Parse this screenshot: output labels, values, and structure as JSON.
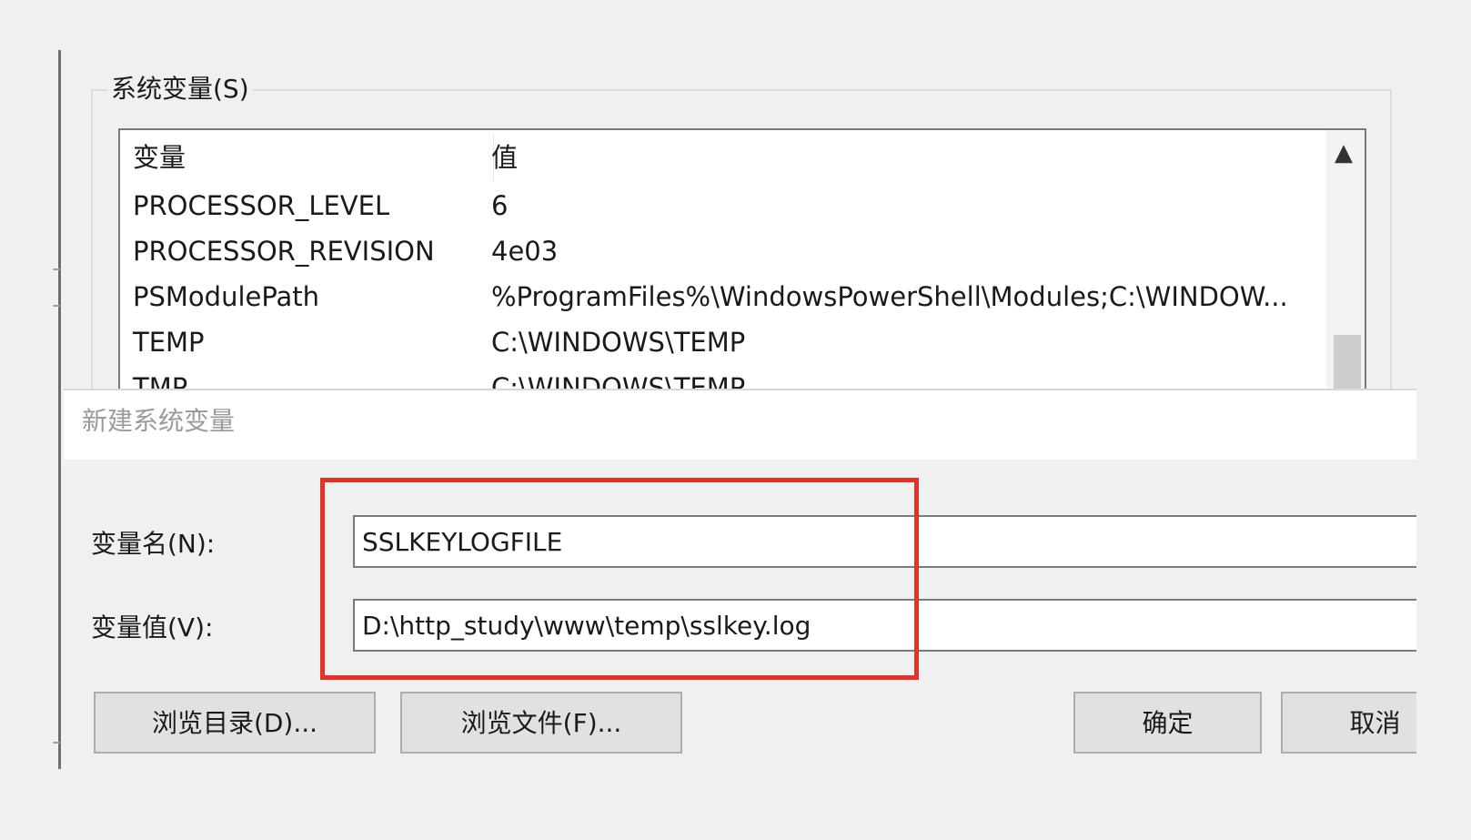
{
  "system_vars": {
    "group_title": "系统变量(S)",
    "columns": {
      "name": "变量",
      "value": "值"
    },
    "rows": [
      {
        "name": "PROCESSOR_LEVEL",
        "value": "6"
      },
      {
        "name": "PROCESSOR_REVISION",
        "value": "4e03"
      },
      {
        "name": "PSModulePath",
        "value": "%ProgramFiles%\\WindowsPowerShell\\Modules;C:\\WINDOW..."
      },
      {
        "name": "TEMP",
        "value": "C:\\WINDOWS\\TEMP"
      },
      {
        "name": "TMP",
        "value": "C:\\WINDOWS\\TEMP"
      }
    ],
    "scroll_up_icon": "▲"
  },
  "dialog": {
    "title": "新建系统变量",
    "name_label": "变量名(N):",
    "name_value": "SSLKEYLOGFILE",
    "value_label": "变量值(V):",
    "value_value": "D:\\http_study\\www\\temp\\sslkey.log",
    "buttons": {
      "browse_dir": "浏览目录(D)...",
      "browse_file": "浏览文件(F)...",
      "ok": "确定",
      "cancel": "取消"
    }
  },
  "colors": {
    "highlight": "#e53228",
    "background": "#f0f0f0"
  }
}
